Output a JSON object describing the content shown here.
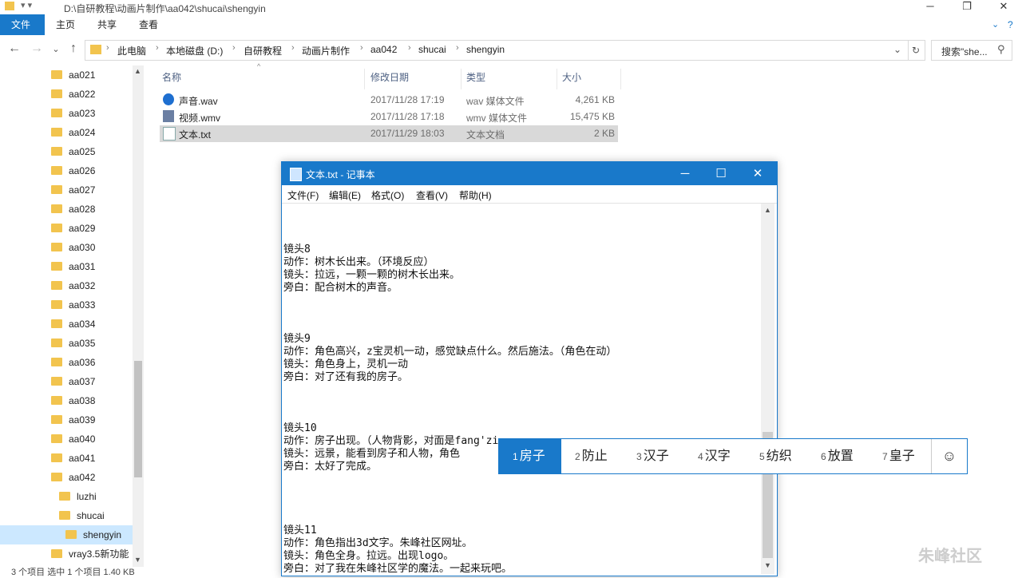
{
  "window": {
    "title_path": "D:\\自研教程\\动画片制作\\aa042\\shucai\\shengyin"
  },
  "ribbon": {
    "tabs": [
      "文件",
      "主页",
      "共享",
      "查看"
    ]
  },
  "address": {
    "crumbs": [
      "此电脑",
      "本地磁盘 (D:)",
      "自研教程",
      "动画片制作",
      "aa042",
      "shucai",
      "shengyin"
    ]
  },
  "search": {
    "placeholder": "搜索\"she..."
  },
  "sidebar": {
    "items": [
      {
        "label": "aa021",
        "level": 0
      },
      {
        "label": "aa022",
        "level": 0
      },
      {
        "label": "aa023",
        "level": 0
      },
      {
        "label": "aa024",
        "level": 0
      },
      {
        "label": "aa025",
        "level": 0
      },
      {
        "label": "aa026",
        "level": 0
      },
      {
        "label": "aa027",
        "level": 0
      },
      {
        "label": "aa028",
        "level": 0
      },
      {
        "label": "aa029",
        "level": 0
      },
      {
        "label": "aa030",
        "level": 0
      },
      {
        "label": "aa031",
        "level": 0
      },
      {
        "label": "aa032",
        "level": 0
      },
      {
        "label": "aa033",
        "level": 0
      },
      {
        "label": "aa034",
        "level": 0
      },
      {
        "label": "aa035",
        "level": 0
      },
      {
        "label": "aa036",
        "level": 0
      },
      {
        "label": "aa037",
        "level": 0
      },
      {
        "label": "aa038",
        "level": 0
      },
      {
        "label": "aa039",
        "level": 0
      },
      {
        "label": "aa040",
        "level": 0
      },
      {
        "label": "aa041",
        "level": 0
      },
      {
        "label": "aa042",
        "level": 0
      },
      {
        "label": "luzhi",
        "level": 1
      },
      {
        "label": "shucai",
        "level": 1
      },
      {
        "label": "shengyin",
        "level": 2,
        "selected": true
      },
      {
        "label": "vray3.5新功能",
        "level": 0
      }
    ]
  },
  "filelist": {
    "headers": {
      "name": "名称",
      "date": "修改日期",
      "type": "类型",
      "size": "大小"
    },
    "files": [
      {
        "name": "声音.wav",
        "date": "2017/11/28 17:19",
        "type": "wav 媒体文件",
        "size": "4,261 KB",
        "icon": "audio-file-icon"
      },
      {
        "name": "视频.wmv",
        "date": "2017/11/28 17:18",
        "type": "wmv 媒体文件",
        "size": "15,475 KB",
        "icon": "video-file-icon"
      },
      {
        "name": "文本.txt",
        "date": "2017/11/29 18:03",
        "type": "文本文档",
        "size": "2 KB",
        "icon": "text-file-icon",
        "selected": true
      }
    ]
  },
  "notepad": {
    "title": "文本.txt - 记事本",
    "menu": [
      "文件(F)",
      "编辑(E)",
      "格式(O)",
      "查看(V)",
      "帮助(H)"
    ],
    "text": "\n\n\n镜头8\n动作：树木长出来。（环境反应）\n镜头：拉远，一颗一颗的树木长出来。\n旁白：配合树木的声音。\n\n\n\n镜头9\n动作：角色高兴，z宝灵机一动，感觉缺点什么。然后施法。（角色在动）\n镜头：角色身上，灵机一动\n旁白：对了还有我的房子。\n\n\n\n镜头10\n动作：房子出现。（人物背影，对面是fang'zi\n镜头：远景，能看到房子和人物，角色\n旁白：太好了完成。\n\n\n\n\n镜头11\n动作：角色指出3d文字。朱峰社区网址。\n镜头：角色全身。拉远。出现logo。\n旁白：对了我在朱峰社区学的魔法。一起来玩吧。"
  },
  "ime": {
    "candidates": [
      {
        "n": "1",
        "text": "房子",
        "selected": true
      },
      {
        "n": "2",
        "text": "防止"
      },
      {
        "n": "3",
        "text": "汉子"
      },
      {
        "n": "4",
        "text": "汉字"
      },
      {
        "n": "5",
        "text": "纺织"
      },
      {
        "n": "6",
        "text": "放置"
      },
      {
        "n": "7",
        "text": "皇子"
      }
    ],
    "emoji": "☺"
  },
  "status": {
    "text": "3 个项目    选中 1 个项目  1.40 KB"
  },
  "watermark": {
    "text": "朱峰社区"
  },
  "colors": {
    "accent": "#1979ca",
    "folder": "#f2c44e",
    "selection": "#cce8ff"
  }
}
